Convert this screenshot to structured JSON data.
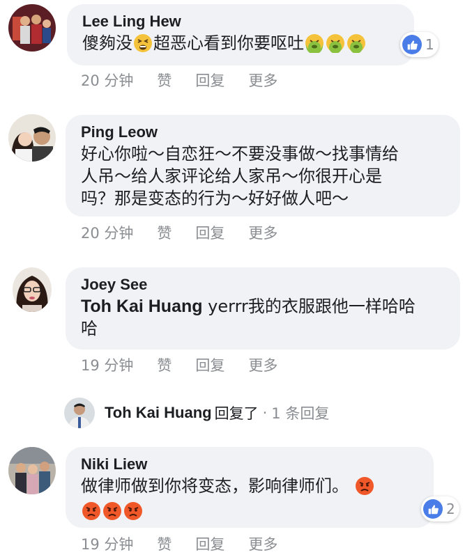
{
  "comments": [
    {
      "author": "Lee Ling Hew",
      "text_parts": [
        "傻夠没",
        "超恶心看到你要呕吐"
      ],
      "time": "20 分钟",
      "like": "赞",
      "reply": "回复",
      "more": "更多",
      "reaction_count": "1",
      "reaction_type": "like",
      "emoji": [
        "tired-face",
        "nauseated-face",
        "nauseated-face",
        "nauseated-face"
      ]
    },
    {
      "author": "Ping Leow",
      "lines": [
        "好心你啦～自恋狂～不要没事做～找事情给",
        "人吊～给人家评论给人家吊～你很开心是",
        "吗？那是变态的行为～好好做人吧～"
      ],
      "time": "20 分钟",
      "like": "赞",
      "reply": "回复",
      "more": "更多"
    },
    {
      "author": "Joey See",
      "mention": "Toh Kai Huang",
      "lines": [
        " yerrr我的衣服跟他一样哈哈",
        "哈"
      ],
      "time": "19 分钟",
      "like": "赞",
      "reply": "回复",
      "more": "更多"
    },
    {
      "author": "Niki Liew",
      "text": "做律师做到你将变态，影响律师们。",
      "time": "19 分钟",
      "like": "赞",
      "reply": "回复",
      "more": "更多",
      "reaction_count": "2",
      "reaction_type": "like",
      "emoji": [
        "pouting-face",
        "pouting-face",
        "pouting-face",
        "pouting-face"
      ]
    }
  ],
  "reply_thread": {
    "name": "Toh Kai Huang",
    "action": "回复了",
    "separator": "·",
    "count": "1 条回复"
  },
  "colors": {
    "bubble": "#f0f2f5",
    "meta": "#8a8d91",
    "like_blue": "#4a7de8",
    "emoji_yellow": "#f5c33b",
    "emoji_green": "#8ac23f",
    "emoji_red": "#f0582a"
  }
}
